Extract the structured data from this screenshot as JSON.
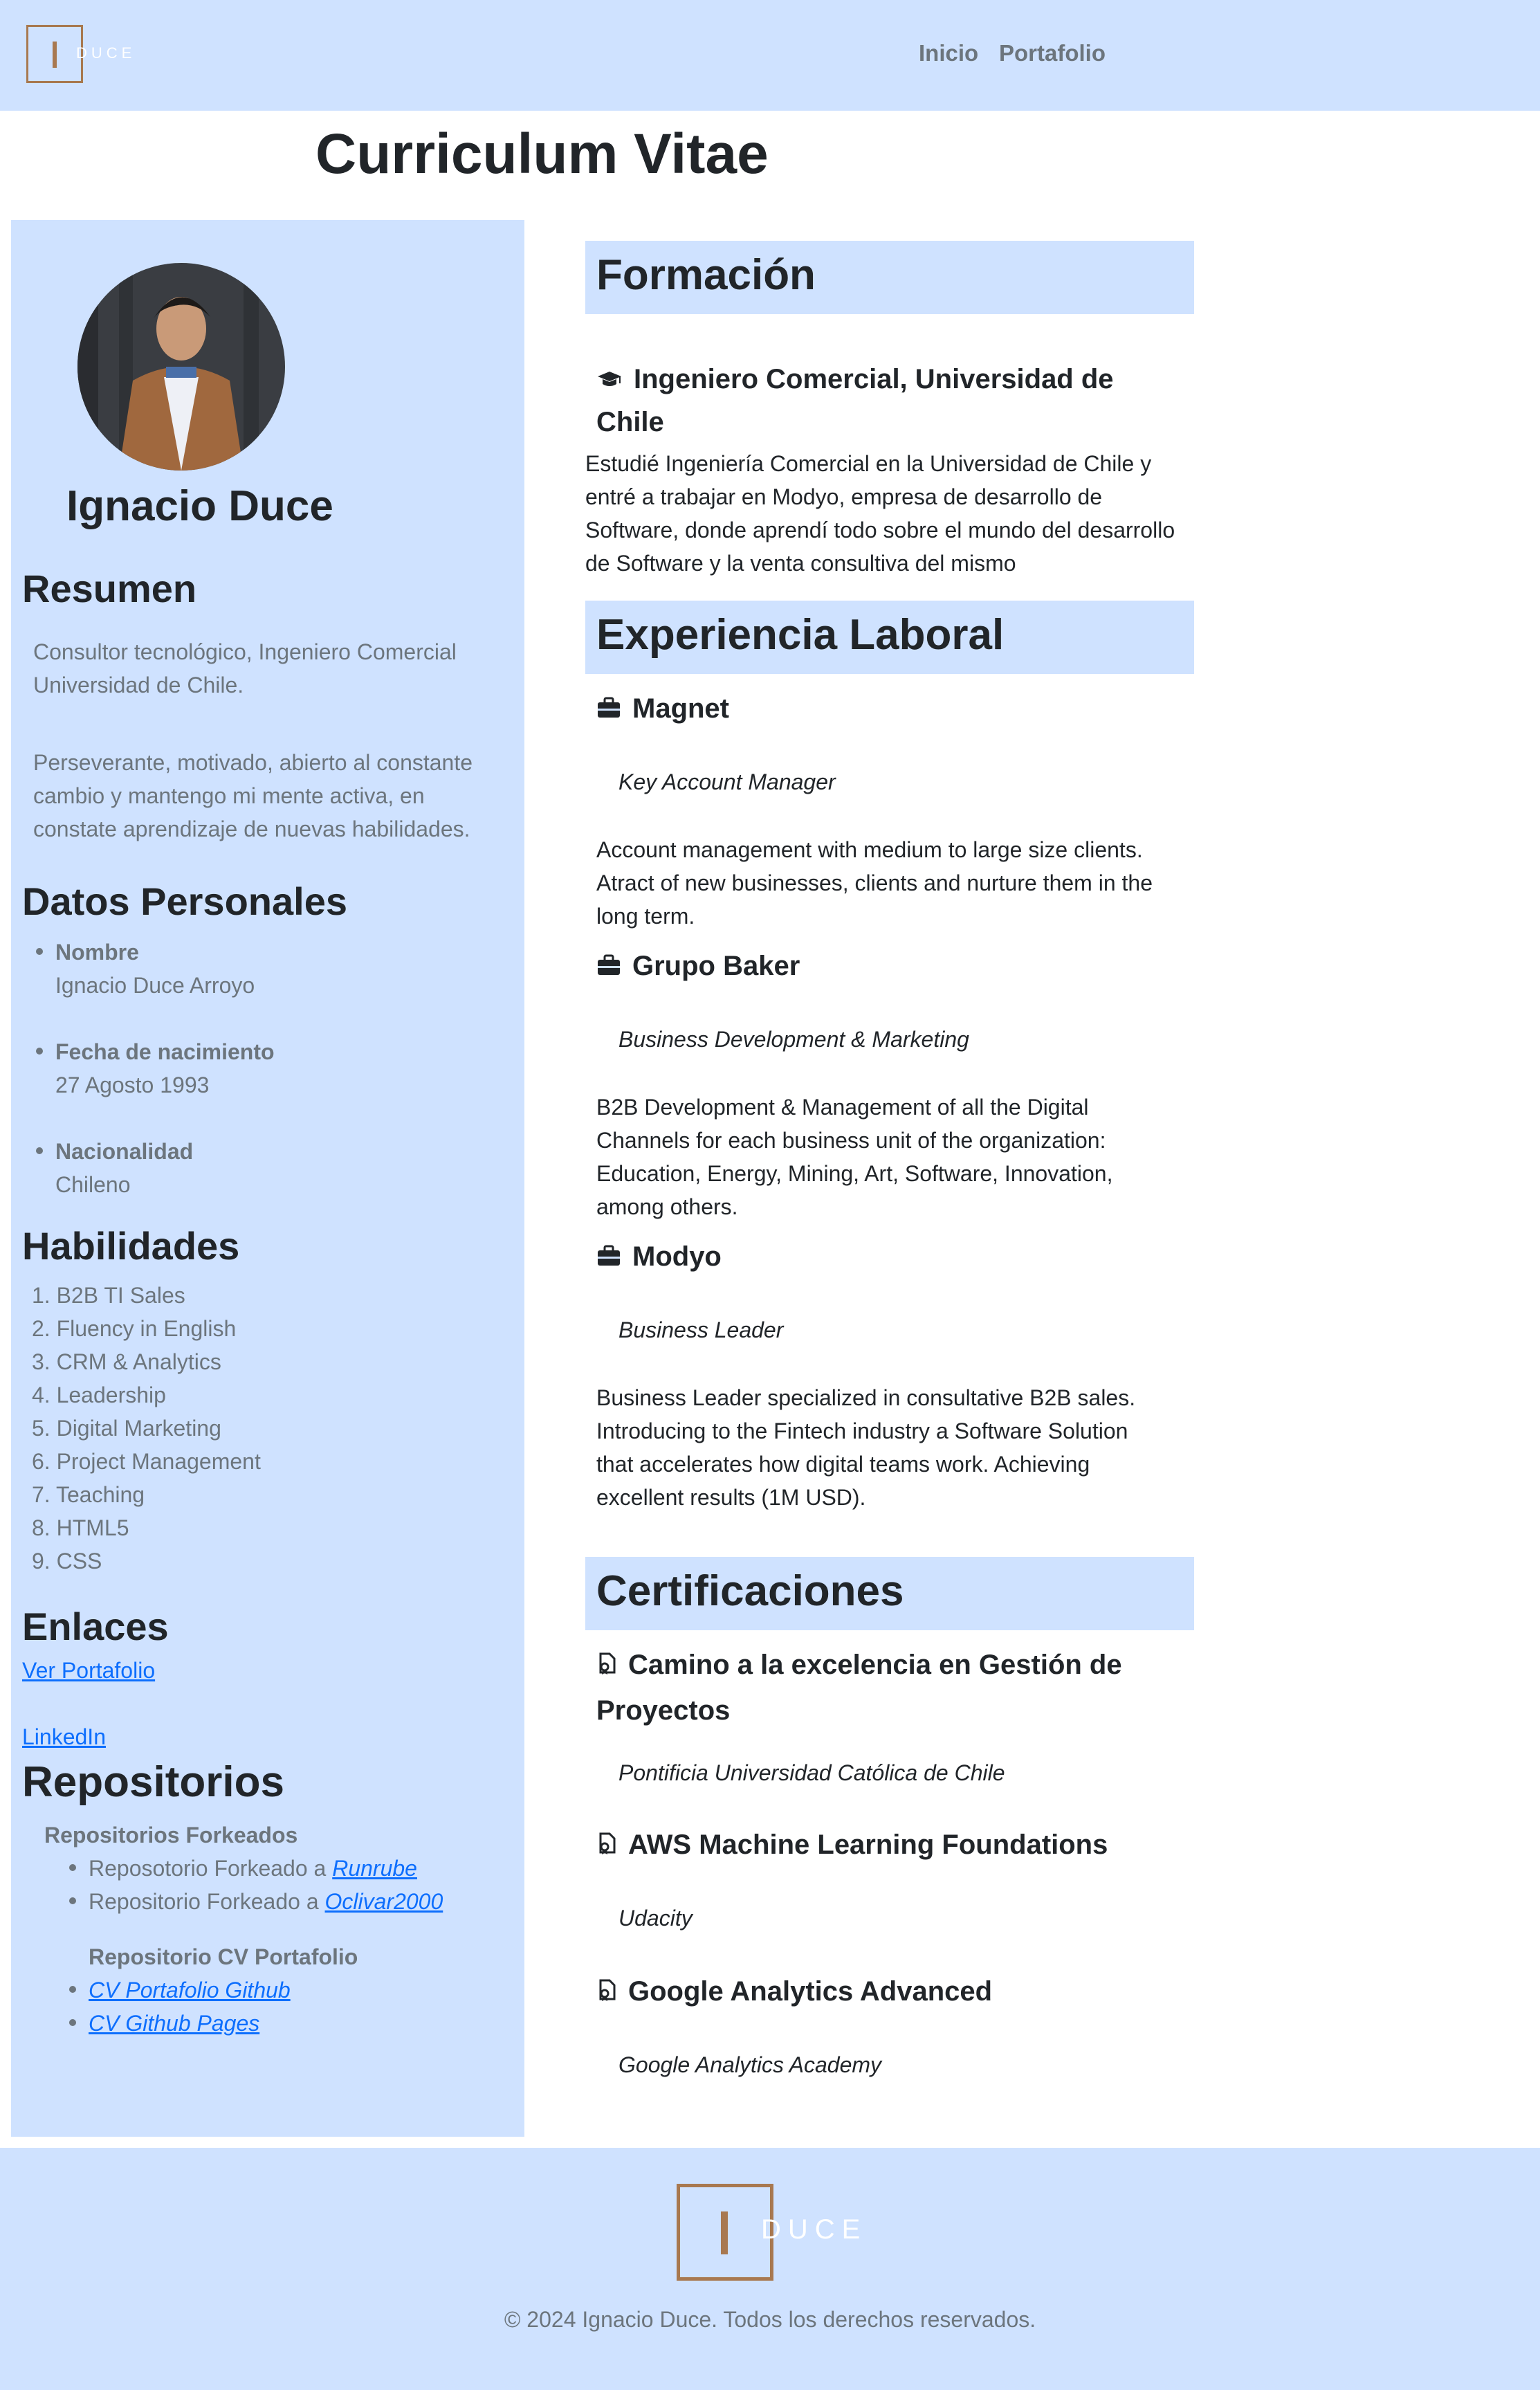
{
  "header": {
    "logo_text": "DUCE",
    "nav": [
      "Inicio",
      "Portafolio"
    ]
  },
  "page_title": "Curriculum Vitae",
  "sidebar": {
    "name": "Ignacio Duce",
    "resumen_title": "Resumen",
    "resumen_p1": "Consultor tecnológico, Ingeniero Comercial Universidad de Chile.",
    "resumen_p2": "Perseverante, motivado, abierto al constante cambio y mantengo mi mente activa, en constate aprendizaje de nuevas habilidades.",
    "datos_title": "Datos Personales",
    "datos": [
      {
        "label": "Nombre",
        "value": "Ignacio Duce Arroyo"
      },
      {
        "label": "Fecha de nacimiento",
        "value": "27 Agosto 1993"
      },
      {
        "label": "Nacionalidad",
        "value": "Chileno"
      }
    ],
    "habilidades_title": "Habilidades",
    "habilidades": [
      "B2B TI Sales",
      "Fluency in English",
      "CRM & Analytics",
      "Leadership",
      "Digital Marketing",
      "Project Management",
      "Teaching",
      "HTML5",
      "CSS"
    ],
    "enlaces_title": "Enlaces",
    "enlaces": [
      "Ver Portafolio",
      "LinkedIn"
    ],
    "repos_title": "Repositorios",
    "forked_title": "Repositorios Forkeados",
    "forked": [
      {
        "prefix": "Reposotorio Forkeado a ",
        "link": "Runrube"
      },
      {
        "prefix": "Repositorio Forkeado a ",
        "link": "Oclivar2000"
      }
    ],
    "cv_repo_title": "Repositorio CV Portafolio",
    "cv_repos": [
      "CV Portafolio Github",
      "CV Github Pages"
    ]
  },
  "formacion": {
    "title": "Formación",
    "degree": "Ingeniero Comercial, Universidad de Chile",
    "description": "Estudié Ingeniería Comercial en la Universidad de Chile y entré a trabajar en Modyo, empresa de desarrollo de Software, donde aprendí todo sobre el mundo del desarrollo de Software y la venta consultiva del mismo"
  },
  "experiencia": {
    "title": "Experiencia Laboral",
    "jobs": [
      {
        "company": "Magnet",
        "role": "Key Account Manager",
        "description": "Account management with medium to large size clients. Atract of new businesses, clients and nurture them in the long term."
      },
      {
        "company": "Grupo Baker",
        "role": "Business Development & Marketing",
        "description": "B2B Development & Management of all the Digital Channels for each business unit of the organization: Education, Energy, Mining, Art, Software, Innovation, among others."
      },
      {
        "company": "Modyo",
        "role": "Business Leader",
        "description": "Business Leader specialized in consultative B2B sales. Introducing to the Fintech industry a Software Solution that accelerates how digital teams work. Achieving excellent results (1M USD)."
      }
    ]
  },
  "certificaciones": {
    "title": "Certificaciones",
    "items": [
      {
        "name": "Camino a la excelencia en Gestión de Proyectos",
        "issuer": "Pontificia Universidad Católica de Chile"
      },
      {
        "name": "AWS Machine Learning Foundations",
        "issuer": "Udacity"
      },
      {
        "name": "Google Analytics Advanced",
        "issuer": "Google Analytics Academy"
      }
    ]
  },
  "footer": {
    "logo_text": "DUCE",
    "copyright": "© 2024 Ignacio Duce. Todos los derechos reservados."
  },
  "colors": {
    "accent_bg": "#cfe2ff",
    "logo_brown": "#a87850",
    "link": "#0d6efd",
    "muted_text": "#6c757d"
  },
  "icons": [
    "graduation-cap-icon",
    "briefcase-icon",
    "certificate-icon"
  ]
}
